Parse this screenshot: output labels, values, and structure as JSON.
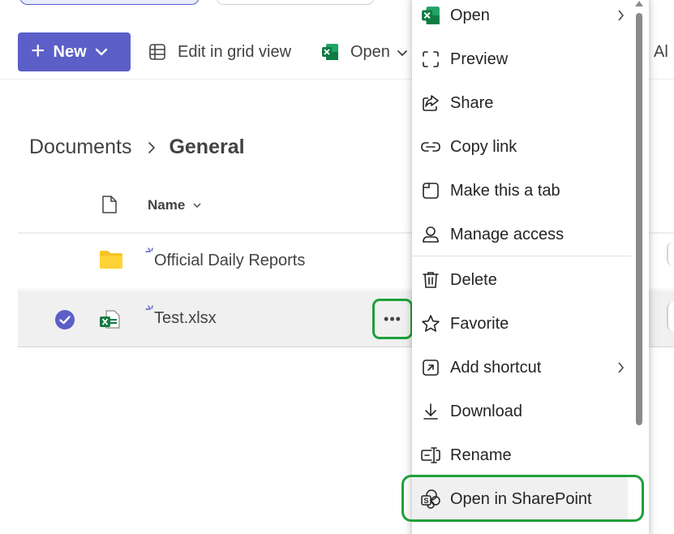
{
  "commandbar": {
    "new_label": "New",
    "edit_grid_label": "Edit in grid view",
    "open_label": "Open",
    "overflow_label": "Al"
  },
  "breadcrumb": {
    "parent": "Documents",
    "current": "General"
  },
  "list": {
    "column_name": "Name",
    "rows": [
      {
        "name": "Official Daily Reports",
        "type": "folder",
        "selected": false
      },
      {
        "name": "Test.xlsx",
        "type": "excel",
        "selected": true
      }
    ]
  },
  "context_menu": {
    "items": [
      {
        "label": "Open",
        "icon": "excel-icon",
        "submenu": true
      },
      {
        "label": "Preview",
        "icon": "preview-icon"
      },
      {
        "label": "Share",
        "icon": "share-icon"
      },
      {
        "label": "Copy link",
        "icon": "link-icon"
      },
      {
        "label": "Make this a tab",
        "icon": "tab-icon"
      },
      {
        "label": "Manage access",
        "icon": "person-icon"
      },
      {
        "label": "Delete",
        "icon": "trash-icon"
      },
      {
        "label": "Favorite",
        "icon": "star-icon"
      },
      {
        "label": "Add shortcut",
        "icon": "shortcut-icon",
        "submenu": true
      },
      {
        "label": "Download",
        "icon": "download-icon"
      },
      {
        "label": "Rename",
        "icon": "rename-icon"
      },
      {
        "label": "Open in SharePoint",
        "icon": "sharepoint-icon",
        "highlighted": true
      }
    ]
  },
  "colors": {
    "accent": "#5b5fc7",
    "highlight_outline": "#1fa03a",
    "excel_green": "#107c41",
    "folder_yellow": "#f6c324"
  }
}
